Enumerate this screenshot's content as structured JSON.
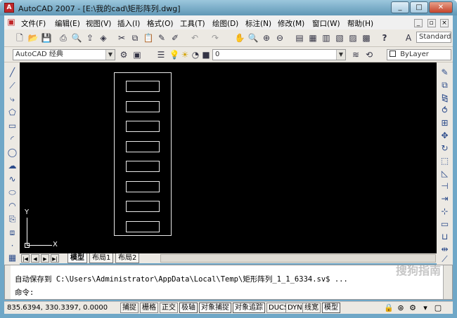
{
  "window": {
    "title": "AutoCAD 2007 - [E:\\我的cad\\矩形阵列.dwg]",
    "minimize": "_",
    "maximize": "□",
    "close": "✕"
  },
  "menu": {
    "items": [
      "文件(F)",
      "编辑(E)",
      "视图(V)",
      "插入(I)",
      "格式(O)",
      "工具(T)",
      "绘图(D)",
      "标注(N)",
      "修改(M)",
      "窗口(W)",
      "帮助(H)"
    ],
    "mdi_min": "_",
    "mdi_restore": "▫",
    "mdi_close": "×"
  },
  "toolbar1": {
    "icons": [
      "new-icon",
      "open-icon",
      "save-icon",
      "plot-icon",
      "plot-preview-icon",
      "publish-icon",
      "3d-dwf-icon",
      "cut-icon",
      "copy-icon",
      "paste-icon",
      "match-properties-icon",
      "block-editor-icon",
      "undo-icon",
      "redo-icon",
      "pan-icon",
      "zoom-realtime-icon",
      "zoom-window-icon",
      "zoom-previous-icon",
      "properties-icon",
      "design-center-icon",
      "tool-palettes-icon",
      "sheet-set-icon",
      "markup-icon",
      "calculator-icon",
      "help-icon"
    ],
    "text_style_combo": "Standard"
  },
  "toolbar2": {
    "workspace_combo": "AutoCAD 经典",
    "layer_combo": "0",
    "color_combo": "ByLayer"
  },
  "left_toolbar": {
    "icons": [
      "line-icon",
      "construction-line-icon",
      "polyline-icon",
      "polygon-icon",
      "rectangle-icon",
      "arc-icon",
      "circle-icon",
      "revision-cloud-icon",
      "spline-icon",
      "ellipse-icon",
      "ellipse-arc-icon",
      "insert-block-icon",
      "make-block-icon",
      "point-icon",
      "hatch-icon"
    ]
  },
  "right_toolbar": {
    "icons": [
      "erase-icon",
      "copy-object-icon",
      "mirror-icon",
      "offset-icon",
      "array-icon",
      "move-icon",
      "rotate-icon",
      "scale-icon",
      "stretch-icon",
      "trim-icon",
      "extend-icon",
      "break-at-point-icon",
      "break-icon",
      "join-icon",
      "chamfer-icon",
      "fillet-icon",
      "explode-icon"
    ]
  },
  "canvas": {
    "background": "#000000",
    "ucs_x_label": "X",
    "ucs_y_label": "Y",
    "rect_array_rows": 8
  },
  "layout_tabs": {
    "tabs": [
      "模型",
      "布局1",
      "布局2"
    ],
    "active": "模型"
  },
  "command": {
    "line1": "自动保存到 C:\\Users\\Administrator\\AppData\\Local\\Temp\\矩形阵列_1_1_6334.sv$ ...",
    "prompt": "命令:",
    "watermark": "搜狗指南"
  },
  "status": {
    "coordinates": "835.6394,  330.3397, 0.0000",
    "buttons": [
      "捕捉",
      "栅格",
      "正交",
      "极轴",
      "对象捕捉",
      "对象追踪",
      "DUCS",
      "DYN",
      "线宽",
      "模型"
    ]
  }
}
